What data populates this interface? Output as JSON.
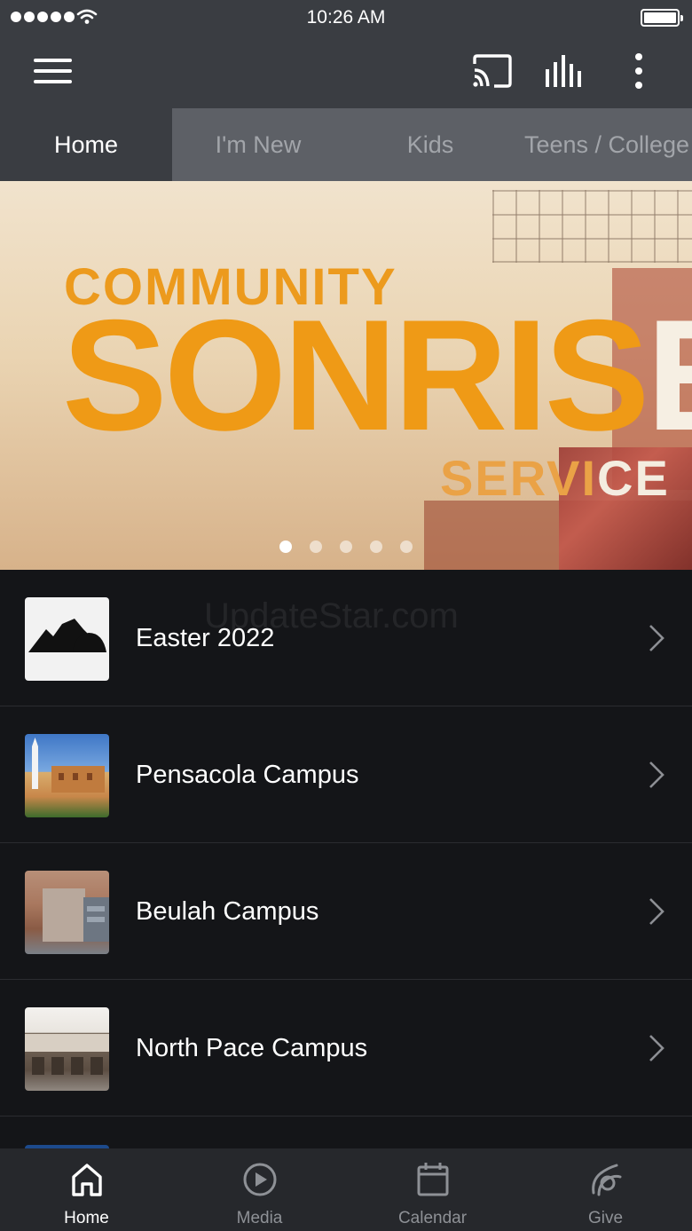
{
  "status_bar": {
    "time": "10:26 AM",
    "signal_icon": "signal-dots-icon",
    "wifi_icon": "wifi-icon",
    "battery_icon": "battery-icon"
  },
  "app_bar": {
    "menu_icon": "hamburger-menu-icon",
    "cast_icon": "cast-icon",
    "audio_icon": "audio-bars-icon",
    "more_icon": "more-vertical-icon"
  },
  "tabs": [
    {
      "label": "Home",
      "active": true
    },
    {
      "label": "I'm New",
      "active": false
    },
    {
      "label": "Kids",
      "active": false
    },
    {
      "label": "Teens / College",
      "active": false
    }
  ],
  "hero": {
    "line1": "COMMUNITY",
    "line2_a": "SONRIS",
    "line2_b": "E",
    "line3_a": "SERVI",
    "line3_b": "CE",
    "slide_count": 5,
    "active_slide": 1
  },
  "watermark": "UpdateStar.com",
  "list_items": [
    {
      "label": "Easter 2022",
      "thumb": "mountains-logo"
    },
    {
      "label": "Pensacola Campus",
      "thumb": "church-building-photo"
    },
    {
      "label": "Beulah Campus",
      "thumb": "school-building-photo"
    },
    {
      "label": "North Pace Campus",
      "thumb": "middle-school-photo"
    }
  ],
  "bottom_nav": [
    {
      "label": "Home",
      "icon": "home-icon",
      "active": true
    },
    {
      "label": "Media",
      "icon": "play-circle-icon",
      "active": false
    },
    {
      "label": "Calendar",
      "icon": "calendar-icon",
      "active": false
    },
    {
      "label": "Give",
      "icon": "give-hand-icon",
      "active": false
    }
  ],
  "colors": {
    "status_bar": "#3a3d42",
    "tabs_bg": "#5d6066",
    "list_bg": "#141518",
    "bottom_nav_bg": "#26282c",
    "hero_orange": "#ef9a16"
  }
}
